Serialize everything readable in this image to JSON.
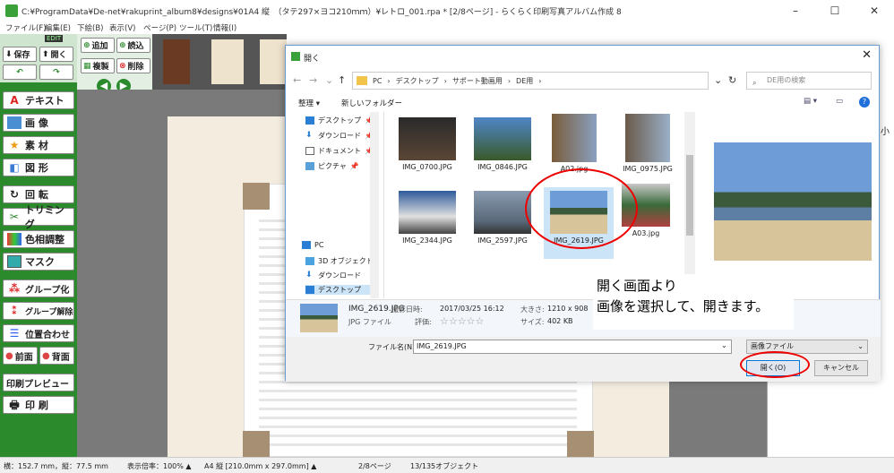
{
  "window": {
    "title": "C:¥ProgramData¥De-net¥rakuprint_album8¥designs¥01A4 縦　（タテ297×ヨコ210ｍｍ）¥レトロ_001.rpa * [2/8ページ] - らくらく印刷写真アルバム作成 8",
    "controls": {
      "minimize": "–",
      "maximize": "☐",
      "close": "✕"
    }
  },
  "menu": [
    "ファイル(F)",
    "編集(E)",
    "下絵(B)",
    "表示(V)",
    "ページ(P)",
    "ツール(T)",
    "情報(I)"
  ],
  "left_toolbar": {
    "save": "保存",
    "open": "開く",
    "edit_badge": "EDIT",
    "tools": [
      "テキスト",
      "画 像",
      "素 材",
      "図 形",
      "回 転",
      "トリミング",
      "色相調整",
      "マスク",
      "グループ化",
      "グループ解除",
      "位置合わせ",
      "前面",
      "背面",
      "印刷プレビュー",
      "印 刷"
    ]
  },
  "page_toolbar": {
    "add": "追加",
    "read": "読込",
    "copy": "複製",
    "delete": "削除"
  },
  "right_panel": {
    "fragment": "小"
  },
  "dialog": {
    "title": "開く",
    "breadcrumb": [
      "PC",
      "デスクトップ",
      "サポート動画用",
      "DE用"
    ],
    "search_placeholder": "DE用の検索",
    "organize": "整理 ▾",
    "new_folder": "新しいフォルダー",
    "nav_items": [
      "デスクトップ",
      "ダウンロード",
      "ドキュメント",
      "ピクチャ",
      "PC",
      "3D オブジェクト",
      "ダウンロード",
      "デスクトップ"
    ],
    "files": [
      "IMG_0700.JPG",
      "IMG_0846.JPG",
      "A02.jpg",
      "IMG_0975.JPG",
      "IMG_2344.JPG",
      "IMG_2597.JPG",
      "IMG_2619.JPG",
      "A03.jpg"
    ],
    "info": {
      "name": "IMG_2619.JPG",
      "type": "JPG ファイル",
      "date_label": "撮影日時:",
      "date": "2017/03/25 16:12",
      "rating_label": "評価:",
      "stars": "☆☆☆☆☆",
      "size_label": "大きさ:",
      "size": "1210 x 908",
      "filesize_label": "サイズ:",
      "filesize": "402 KB"
    },
    "filename_label": "ファイル名(N):",
    "filename_value": "IMG_2619.JPG",
    "filetype": "画像ファイル",
    "open_button": "開く(O)",
    "cancel_button": "キャンセル"
  },
  "annotation": [
    "開く画面より",
    "画像を選択して、開きます。"
  ],
  "status": {
    "coords": "横：152.7 mm，縦：77.5 mm",
    "zoom": "表示倍率：100% ▲",
    "paper": "A4 縦 [210.0mm x 297.0mm] ▲",
    "page": "2/8ページ",
    "objects": "13/135オブジェクト"
  },
  "colors": {
    "toolbar_green": "#2b8a2b",
    "highlight_red": "#e00000",
    "accent_blue": "#0078d7"
  }
}
